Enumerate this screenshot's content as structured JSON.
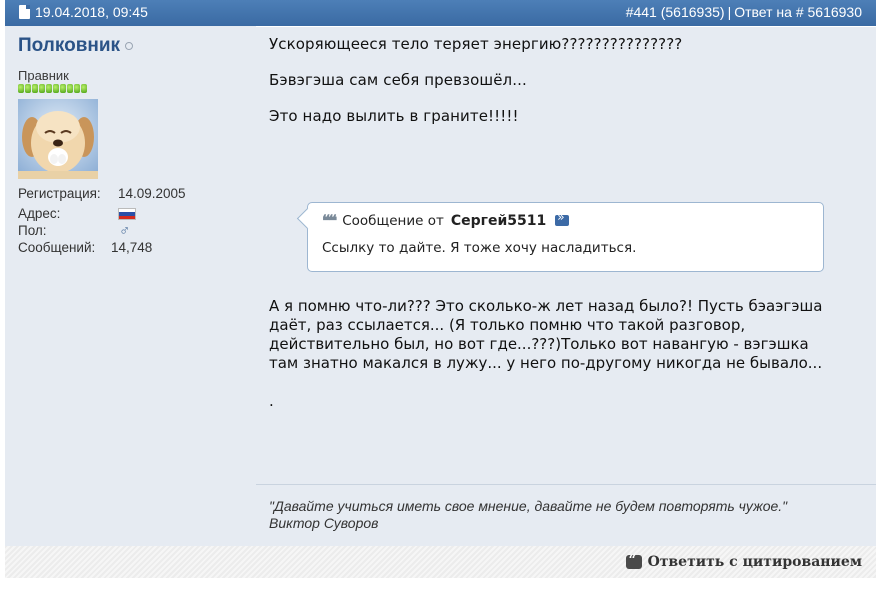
{
  "post": {
    "date": "19.04.2018, 09:45",
    "number": "#441 (5616935)",
    "separator": "|",
    "reply_to": "Ответ на # 5616930"
  },
  "user": {
    "name": "Полковник",
    "title": "Правник",
    "reputation_level": 10,
    "fields": {
      "registration_label": "Регистрация:",
      "registration_value": "14.09.2005",
      "address_label": "Адрес:",
      "gender_label": "Пол:",
      "gender_icon": "♂",
      "messages_label": "Сообщений:",
      "messages_value": "14,748"
    }
  },
  "message": {
    "line1": "Ускоряющееся тело теряет энергию???????????????",
    "line2": "Бэвэгэша сам себя превзошёл...",
    "line3": "Это надо вылить в граните!!!!!",
    "quote": {
      "icon": "❝❝",
      "prefix": "Сообщение от",
      "author": "Сергей5511",
      "text": "Ссылку то дайте. Я тоже хочу насладиться."
    },
    "paragraph": [
      "А я помню что-ли??? Это сколько-ж лет назад было?! Пусть бэаэгэша",
      "даёт, раз ссылается... (Я только помню что такой разговор,",
      "действительно был, но вот где...???)Только вот навангую - вэгэшка",
      "там знатно макался в лужу... у него по-другому никогда не бывало..."
    ],
    "tail": "."
  },
  "signature": {
    "quote": "\"Давайте учиться иметь свое мнение, давайте не будем повторять чужое.\"",
    "author": "Виктор Суворов"
  },
  "footer": {
    "reply_quote_label": "Ответить с цитированием"
  },
  "colors": {
    "header": "#3a6aa3",
    "panel": "#e6ebf2",
    "username": "#2b5387",
    "quote_border": "#9db6d1"
  }
}
